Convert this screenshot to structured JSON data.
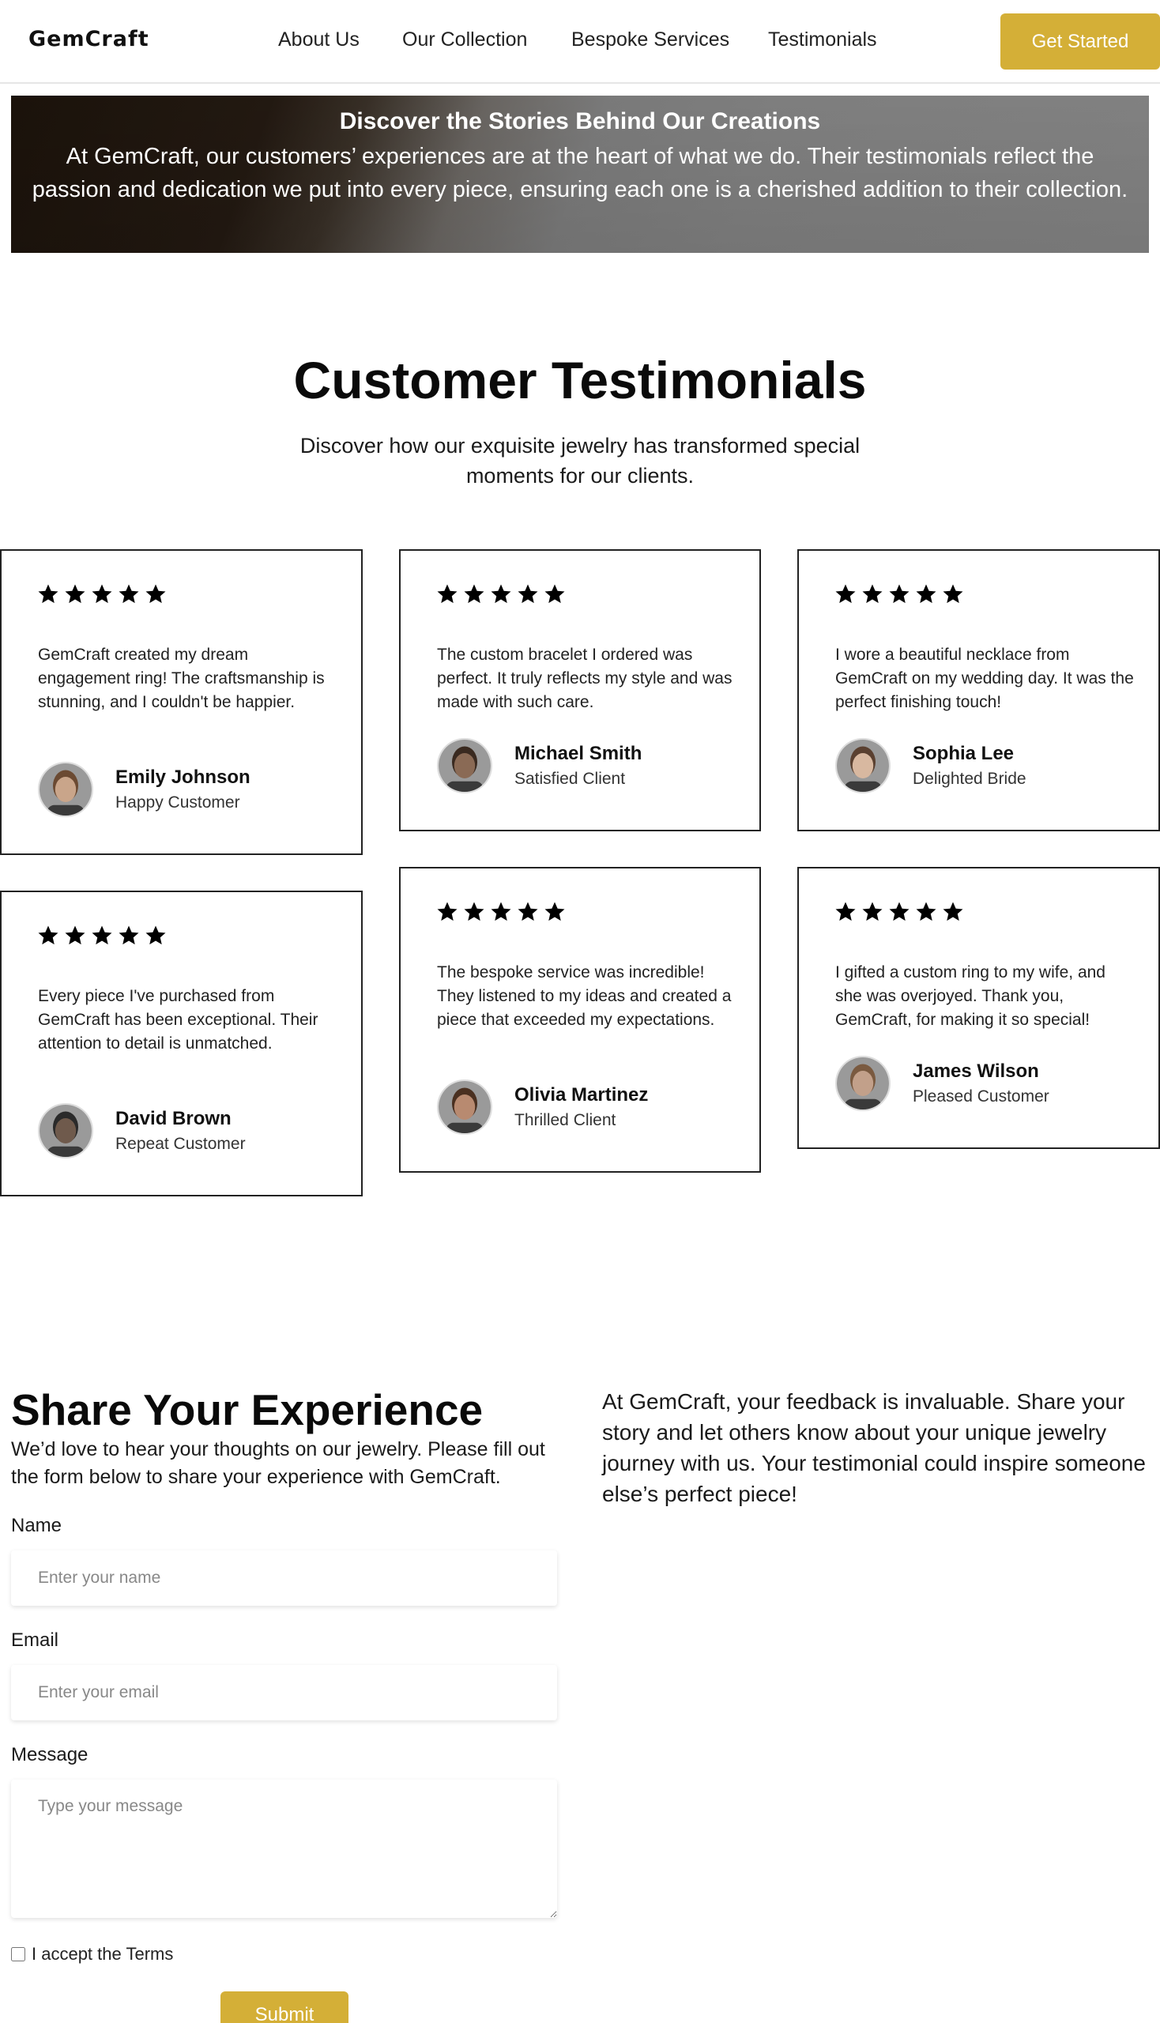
{
  "header": {
    "logo": "GemCraft",
    "nav": [
      "About Us",
      "Our Collection",
      "Bespoke Services",
      "Testimonials"
    ],
    "cta_label": "Get Started"
  },
  "hero": {
    "title": "Discover the Stories Behind Our Creations",
    "text": "At GemCraft, our customers’ experiences are at the heart of what we do. Their testimonials reflect the passion and dedication we put into every piece, ensuring each one is a cherished addition to their collection."
  },
  "testimonials": {
    "title": "Customer Testimonials",
    "subtitle": "Discover how our exquisite jewelry has transformed special moments for our clients.",
    "cards": [
      {
        "rating": 5,
        "quote": "GemCraft created my dream engagement ring! The craftsmanship is stunning, and I couldn't be happier.",
        "name": "Emily Johnson",
        "role": "Happy Customer"
      },
      {
        "rating": 5,
        "quote": "The custom bracelet I ordered was perfect. It truly reflects my style and was made with such care.",
        "name": "Michael Smith",
        "role": "Satisfied Client"
      },
      {
        "rating": 5,
        "quote": "I wore a beautiful necklace from GemCraft on my wedding day. It was the perfect finishing touch!",
        "name": "Sophia Lee",
        "role": "Delighted Bride"
      },
      {
        "rating": 5,
        "quote": "Every piece I've purchased from GemCraft has been exceptional. Their attention to detail is unmatched.",
        "name": "David Brown",
        "role": "Repeat Customer"
      },
      {
        "rating": 5,
        "quote": "The bespoke service was incredible! They listened to my ideas and created a piece that exceeded my expectations.",
        "name": "Olivia Martinez",
        "role": "Thrilled Client"
      },
      {
        "rating": 5,
        "quote": "I gifted a custom ring to my wife, and she was overjoyed. Thank you, GemCraft, for making it so special!",
        "name": "James Wilson",
        "role": "Pleased Customer"
      }
    ]
  },
  "share": {
    "title": "Share Your Experience",
    "subtitle": "We’d love to hear your thoughts on our jewelry. Please fill out the form below to share your experience with GemCraft.",
    "side_text": "At GemCraft, your feedback is invaluable. Share your story and let others know about your unique jewelry journey with us. Your testimonial could inspire someone else’s perfect piece!",
    "form": {
      "name_label": "Name",
      "name_placeholder": "Enter your name",
      "email_label": "Email",
      "email_placeholder": "Enter your email",
      "message_label": "Message",
      "message_placeholder": "Type your message",
      "terms_label": "I accept the Terms",
      "submit_label": "Submit"
    }
  },
  "colors": {
    "accent": "#d4af37",
    "text": "#111111",
    "border": "#222222"
  }
}
